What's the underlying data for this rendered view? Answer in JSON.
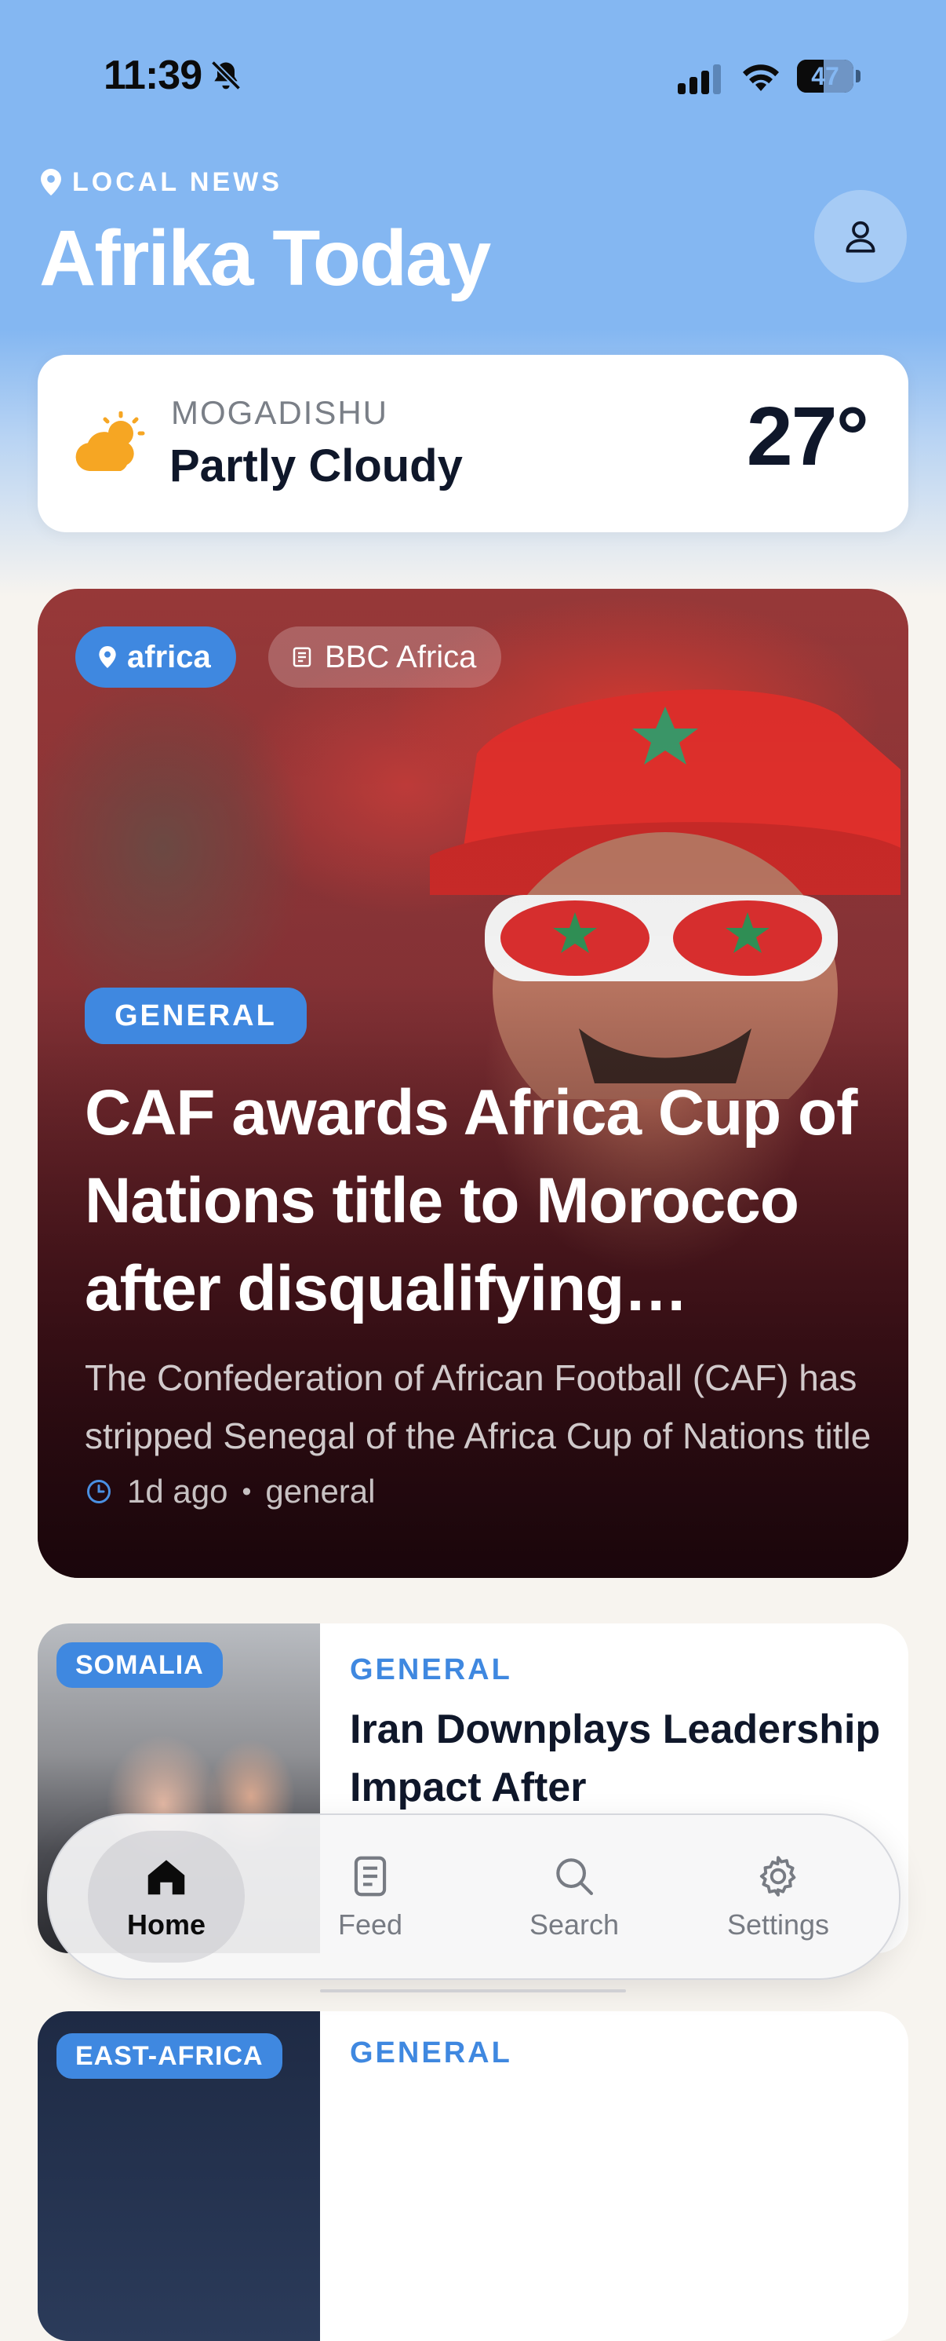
{
  "status_bar": {
    "time": "11:39",
    "battery": "47",
    "battery_fraction": 0.47
  },
  "header": {
    "eyebrow": "LOCAL NEWS",
    "title": "Afrika Today"
  },
  "weather": {
    "city": "MOGADISHU",
    "condition": "Partly Cloudy",
    "temperature": "27°",
    "icon": "partly-cloudy-icon"
  },
  "featured": {
    "region_chip": "africa",
    "source_chip": "BBC Africa",
    "category": "GENERAL",
    "title": "CAF awards Africa Cup of Nations title to Morocco after disqualifying Senegal",
    "summary": "The Confederation of African Football (CAF) has stripped Senegal of the Africa Cup of Nations title",
    "time_ago": "1d ago",
    "separator": "•",
    "tag": "general"
  },
  "articles": [
    {
      "region": "SOMALIA",
      "category": "GENERAL",
      "title": "Iran Downplays Leadership Impact After"
    },
    {
      "region": "EAST-AFRICA",
      "category": "GENERAL",
      "title": ""
    }
  ],
  "tabbar": {
    "tabs": [
      {
        "label": "Home",
        "icon": "house-icon",
        "active": true
      },
      {
        "label": "Feed",
        "icon": "document-icon",
        "active": false
      },
      {
        "label": "Search",
        "icon": "magnifier-icon",
        "active": false
      },
      {
        "label": "Settings",
        "icon": "gear-icon",
        "active": false
      }
    ]
  },
  "colors": {
    "accent": "#3f88e0",
    "header_bg": "#84b7f2",
    "page_bg": "#f7f4ef",
    "weather_icon": "#f6a623"
  }
}
